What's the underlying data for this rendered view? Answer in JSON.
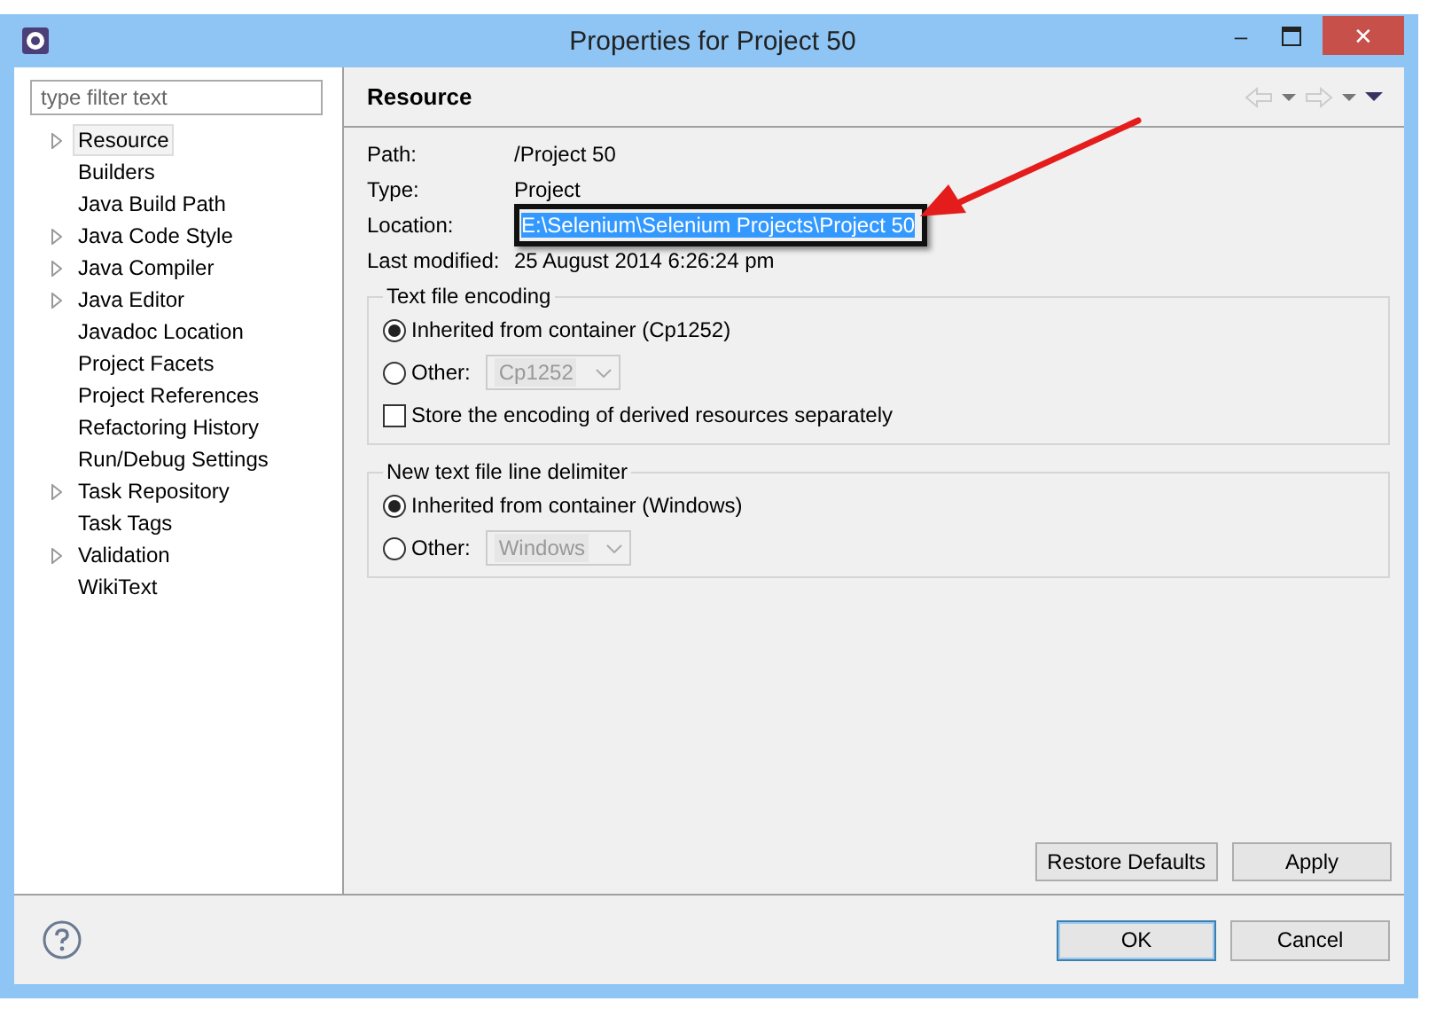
{
  "window": {
    "title": "Properties for Project 50",
    "minimize": "–",
    "close": "✕"
  },
  "filter": {
    "placeholder": "type filter text"
  },
  "tree": [
    {
      "label": "Resource",
      "expandable": true,
      "selected": true
    },
    {
      "label": "Builders",
      "expandable": false,
      "selected": false
    },
    {
      "label": "Java Build Path",
      "expandable": false,
      "selected": false
    },
    {
      "label": "Java Code Style",
      "expandable": true,
      "selected": false
    },
    {
      "label": "Java Compiler",
      "expandable": true,
      "selected": false
    },
    {
      "label": "Java Editor",
      "expandable": true,
      "selected": false
    },
    {
      "label": "Javadoc Location",
      "expandable": false,
      "selected": false
    },
    {
      "label": "Project Facets",
      "expandable": false,
      "selected": false
    },
    {
      "label": "Project References",
      "expandable": false,
      "selected": false
    },
    {
      "label": "Refactoring History",
      "expandable": false,
      "selected": false
    },
    {
      "label": "Run/Debug Settings",
      "expandable": false,
      "selected": false
    },
    {
      "label": "Task Repository",
      "expandable": true,
      "selected": false
    },
    {
      "label": "Task Tags",
      "expandable": false,
      "selected": false
    },
    {
      "label": "Validation",
      "expandable": true,
      "selected": false
    },
    {
      "label": "WikiText",
      "expandable": false,
      "selected": false
    }
  ],
  "page": {
    "title": "Resource",
    "info": [
      {
        "label": "Path:",
        "value": "/Project 50",
        "selected": false,
        "highlighted": false
      },
      {
        "label": "Type:",
        "value": "Project",
        "selected": false,
        "highlighted": false
      },
      {
        "label": "Location:",
        "value": "E:\\Selenium\\Selenium Projects\\Project 50",
        "selected": true,
        "highlighted": true
      },
      {
        "label": "Last modified:",
        "value": "25 August 2014 6:26:24 pm",
        "selected": false,
        "highlighted": false
      }
    ],
    "groups": [
      {
        "title": "Text file encoding",
        "options": [
          {
            "label": "Inherited from container (Cp1252)",
            "selected": true
          },
          {
            "label": "Other:",
            "selected": false,
            "dropdown": "Cp1252",
            "disabled": true
          }
        ],
        "checkbox": {
          "label": "Store the encoding of derived resources separately",
          "checked": false
        }
      },
      {
        "title": "New text file line delimiter",
        "options": [
          {
            "label": "Inherited from container (Windows)",
            "selected": true
          },
          {
            "label": "Other:",
            "selected": false,
            "dropdown": "Windows",
            "disabled": true
          }
        ]
      }
    ],
    "buttons": [
      "Restore Defaults",
      "Apply"
    ]
  },
  "footer": {
    "buttons": [
      {
        "label": "OK",
        "default": true
      },
      {
        "label": "Cancel",
        "default": false
      }
    ]
  }
}
